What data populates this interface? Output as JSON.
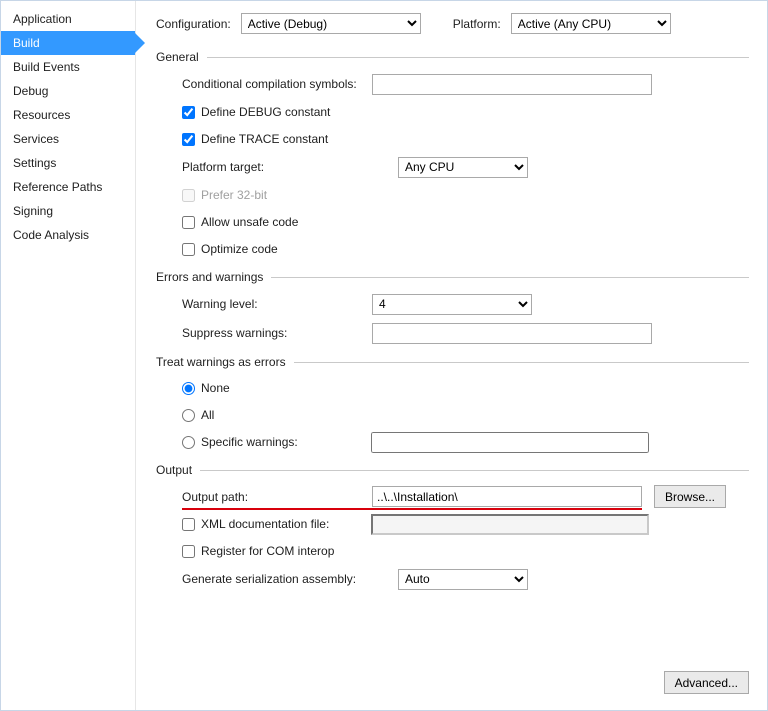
{
  "sidebar": {
    "items": [
      {
        "label": "Application"
      },
      {
        "label": "Build",
        "active": true
      },
      {
        "label": "Build Events"
      },
      {
        "label": "Debug"
      },
      {
        "label": "Resources"
      },
      {
        "label": "Services"
      },
      {
        "label": "Settings"
      },
      {
        "label": "Reference Paths"
      },
      {
        "label": "Signing"
      },
      {
        "label": "Code Analysis"
      }
    ]
  },
  "top": {
    "config_label": "Configuration:",
    "config_value": "Active (Debug)",
    "platform_label": "Platform:",
    "platform_value": "Active (Any CPU)"
  },
  "general": {
    "title": "General",
    "cond_symbols_label": "Conditional compilation symbols:",
    "cond_symbols_value": "",
    "define_debug_label": "Define DEBUG constant",
    "define_debug_checked": true,
    "define_trace_label": "Define TRACE constant",
    "define_trace_checked": true,
    "platform_target_label": "Platform target:",
    "platform_target_value": "Any CPU",
    "prefer_32_label": "Prefer 32-bit",
    "allow_unsafe_label": "Allow unsafe code",
    "optimize_label": "Optimize code"
  },
  "errors": {
    "title": "Errors and warnings",
    "warning_level_label": "Warning level:",
    "warning_level_value": "4",
    "suppress_label": "Suppress warnings:",
    "suppress_value": ""
  },
  "treat": {
    "title": "Treat warnings as errors",
    "none_label": "None",
    "all_label": "All",
    "specific_label": "Specific warnings:",
    "specific_value": "",
    "selected": "none"
  },
  "output": {
    "title": "Output",
    "output_path_label": "Output path:",
    "output_path_value": "..\\..\\Installation\\",
    "browse_label": "Browse...",
    "xml_doc_label": "XML documentation file:",
    "xml_doc_value": "",
    "com_interop_label": "Register for COM interop",
    "gen_serialization_label": "Generate serialization assembly:",
    "gen_serialization_value": "Auto"
  },
  "advanced_label": "Advanced..."
}
